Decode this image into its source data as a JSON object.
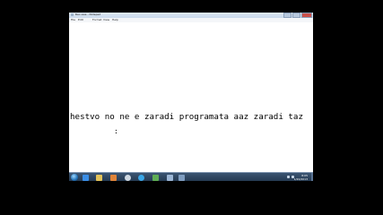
{
  "window": {
    "title": "Без име - Notepad"
  },
  "menubar": {
    "items": [
      "File",
      "Edit",
      "Format",
      "View",
      "Help"
    ]
  },
  "editor": {
    "line1": "hestvo no ne e zaradi programata aaz zaradi taz",
    "line2": ":"
  },
  "taskbar": {
    "icons": [
      "start-orb",
      "ie-icon",
      "explorer-icon",
      "media-player-icon",
      "chrome-icon",
      "skype-icon",
      "app-icon",
      "notepad-icon"
    ],
    "clock_time": "8:05",
    "clock_date": "1/20/2013"
  }
}
